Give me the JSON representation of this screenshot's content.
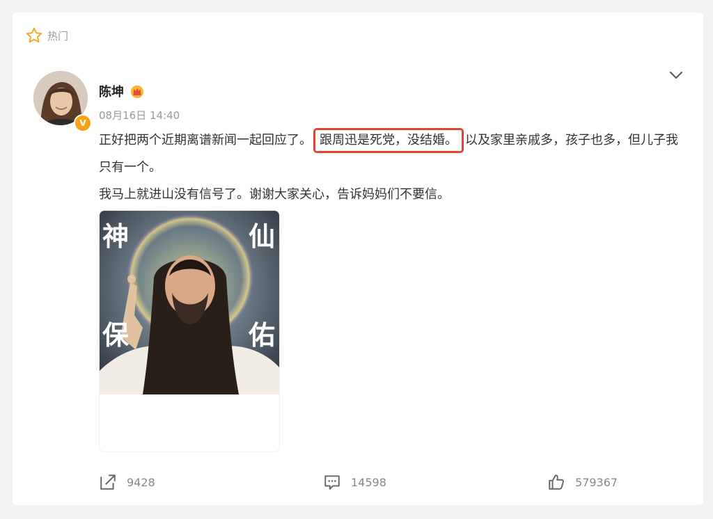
{
  "header": {
    "hot_label": "热门"
  },
  "post": {
    "author": {
      "name": "陈坤",
      "verified": "V"
    },
    "time": "08月16日 14:40",
    "text": {
      "part1": "正好把两个近期离谱新闻一起回应了。",
      "highlight": "跟周迅是死党，没结婚。",
      "part2": "以及家里亲戚多，孩子也多，但儿子我只有一个。",
      "line2": "我马上就进山没有信号了。谢谢大家关心，告诉妈妈们不要信。"
    },
    "image": {
      "caption_chars": [
        "神",
        "仙",
        "保",
        "佑"
      ]
    }
  },
  "actions": {
    "repost_count": "9428",
    "comment_count": "14598",
    "like_count": "579367"
  },
  "colors": {
    "highlight_border": "#e4442f",
    "badge": "#f7a21b",
    "muted_text": "#999999"
  },
  "icons": [
    "star-icon",
    "crown-icon",
    "chevron-down-icon",
    "verified-badge-icon",
    "share-icon",
    "comment-icon",
    "like-icon"
  ]
}
